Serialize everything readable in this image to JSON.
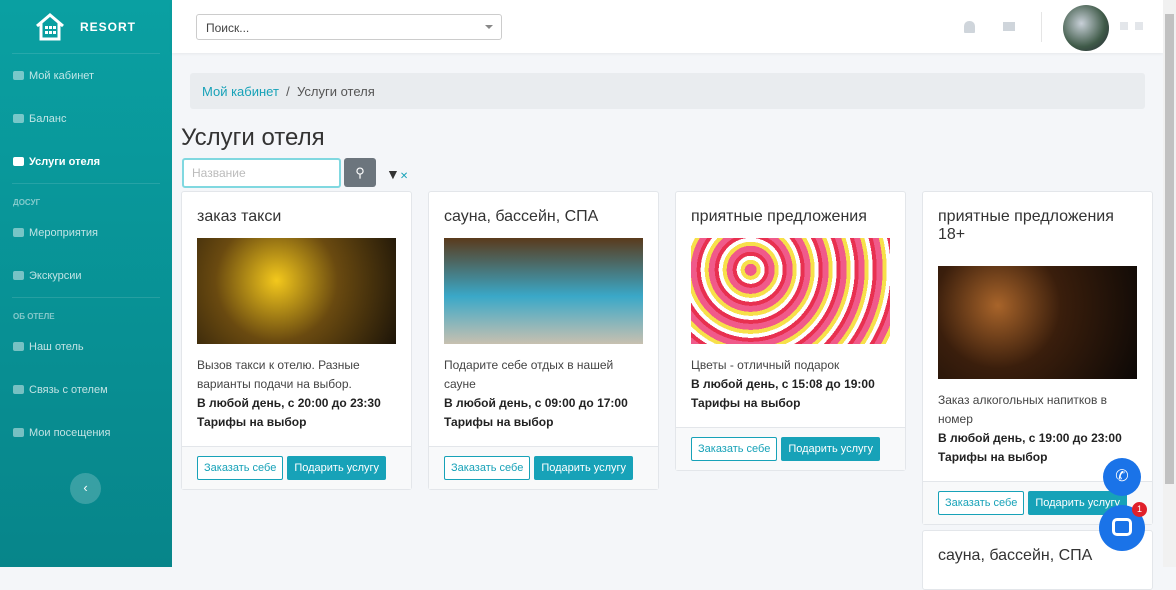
{
  "app": {
    "logo": "RESORT"
  },
  "sidebar": {
    "items": [
      "Мой кабинет",
      "Баланс",
      "Услуги отеля"
    ],
    "sec1": "ДОСУГ",
    "items2": [
      "Мероприятия",
      "Экскурсии"
    ],
    "sec2": "ОБ ОТЕЛЕ",
    "items3": [
      "Наш отель",
      "Связь с отелем",
      "Мои посещения"
    ]
  },
  "header": {
    "search_placeholder": "Поиск..."
  },
  "breadcrumb": {
    "home": "Мой кабинет",
    "sep": "/",
    "current": "Услуги отеля"
  },
  "page": {
    "title": "Услуги отеля",
    "filter_placeholder": "Название"
  },
  "cards": [
    {
      "title": "заказ такси",
      "desc": "Вызов такси к отелю. Разные варианты подачи на выбор.",
      "time": "В любой день, с 20:00 до 23:30",
      "tariff": "Тарифы на выбор"
    },
    {
      "title": "сауна, бассейн, СПА",
      "desc": "Подарите себе отдых в нашей сауне",
      "time": "В любой день, с 09:00 до 17:00",
      "tariff": "Тарифы на выбор"
    },
    {
      "title": "приятные предложения",
      "desc": "Цветы - отличный подарок",
      "time": "В любой день, с 15:08 до 19:00",
      "tariff": "Тарифы на выбор"
    },
    {
      "title": "приятные предложения 18+",
      "desc": "Заказ алкогольных напитков в номер",
      "time": "В любой день, с 19:00 до 23:00",
      "tariff": "Тарифы на выбор"
    },
    {
      "title": "сауна, бассейн, СПА"
    }
  ],
  "buttons": {
    "order": "Заказать себе",
    "gift": "Подарить услугу"
  },
  "chat": {
    "badge": "1"
  }
}
